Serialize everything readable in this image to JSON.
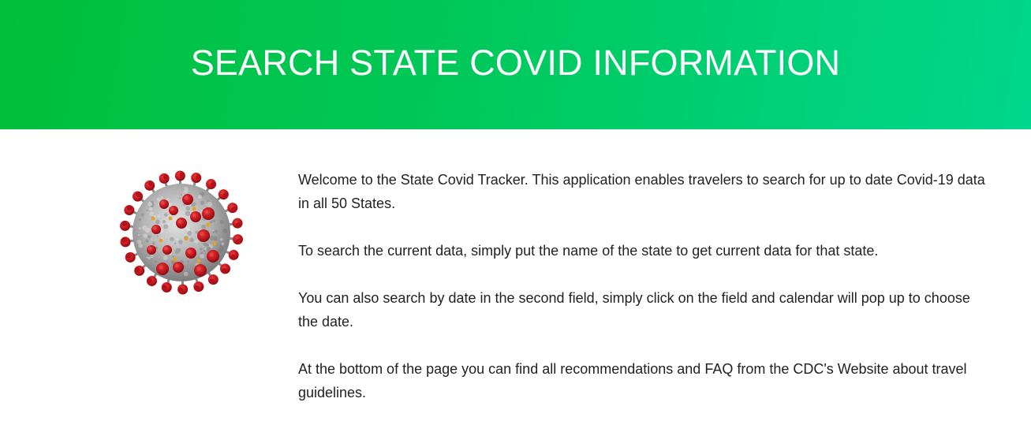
{
  "header": {
    "title": "SEARCH STATE COVID INFORMATION"
  },
  "image": {
    "icon": "coronavirus-icon"
  },
  "intro": {
    "paragraphs": [
      "Welcome to the State Covid Tracker. This application enables travelers to search for up to date Covid-19 data in all 50 States.",
      "To search the current data, simply put the name of the state to get current data for that state.",
      "You can also search by date in the second field, simply click on the field and calendar will pop up to choose the date.",
      "At the bottom of the page you can find all recommendations and FAQ from the CDC's Website about travel guidelines."
    ]
  },
  "colors": {
    "header_gradient_start": "#00bf3a",
    "header_gradient_end": "#00d78e",
    "virus_spike": "#c0141c",
    "virus_body": "#b9b9b9"
  }
}
